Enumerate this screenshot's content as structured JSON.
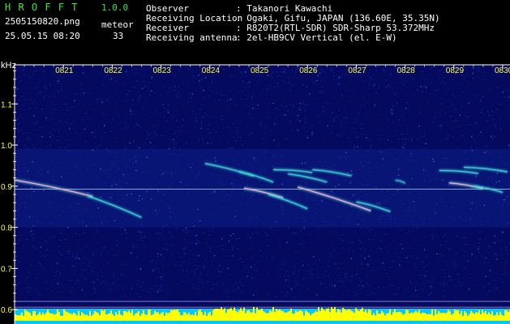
{
  "header": {
    "app_name": "H R O F F T",
    "version": "1.0.0",
    "filename": "2505150820.png",
    "datetime": "25.05.15 08:20",
    "meteor_label": "meteor",
    "meteor_count": "33",
    "info_labels": [
      "Observer",
      "Receiving Location",
      "Receiver",
      "Receiving antenna"
    ],
    "info_values": [
      ": Takanori Kawachi",
      ": Ogaki, Gifu, JAPAN (136.60E, 35.35N)",
      ": R820T2(RTL-SDR) SDR-Sharp 53.372MHz",
      ": 2el-HB9CV Vertical (el. E-W)"
    ]
  },
  "chart_data": {
    "type": "heatmap",
    "ylabel": "kHz",
    "y_ticks": [
      "1.1",
      "1.0",
      "0.9",
      "0.8",
      "0.7",
      "0.6"
    ],
    "y_tick_values": [
      1.1,
      1.0,
      0.9,
      0.8,
      0.7,
      0.6
    ],
    "x_ticks": [
      "0821",
      "0822",
      "0823",
      "0824",
      "0825",
      "0826",
      "0827",
      "0828",
      "0829",
      "0830"
    ],
    "x_tick_minutes": [
      21,
      22,
      23,
      24,
      25,
      26,
      27,
      28,
      29,
      30
    ],
    "x_range_minutes": [
      20.0,
      30.15
    ],
    "ylim": [
      0.565,
      1.195
    ],
    "carrier_khz": 0.893,
    "reference_lines_khz": [
      0.62,
      0.606
    ],
    "echo_traces": [
      {
        "t0": 20.0,
        "f0": 0.915,
        "t1": 21.6,
        "f1": 0.875,
        "intensity": "high"
      },
      {
        "t0": 21.5,
        "f0": 0.876,
        "t1": 22.6,
        "f1": 0.824,
        "intensity": "medium"
      },
      {
        "t0": 23.9,
        "f0": 0.955,
        "t1": 24.9,
        "f1": 0.925,
        "intensity": "medium"
      },
      {
        "t0": 24.6,
        "f0": 0.935,
        "t1": 25.3,
        "f1": 0.91,
        "intensity": "medium"
      },
      {
        "t0": 24.7,
        "f0": 0.895,
        "t1": 25.5,
        "f1": 0.872,
        "intensity": "high"
      },
      {
        "t0": 25.2,
        "f0": 0.88,
        "t1": 26.0,
        "f1": 0.845,
        "intensity": "medium"
      },
      {
        "t0": 25.3,
        "f0": 0.94,
        "t1": 26.1,
        "f1": 0.933,
        "intensity": "medium"
      },
      {
        "t0": 25.6,
        "f0": 0.93,
        "t1": 26.4,
        "f1": 0.91,
        "intensity": "medium"
      },
      {
        "t0": 26.1,
        "f0": 0.94,
        "t1": 26.9,
        "f1": 0.925,
        "intensity": "medium"
      },
      {
        "t0": 25.8,
        "f0": 0.898,
        "t1": 27.3,
        "f1": 0.84,
        "intensity": "high"
      },
      {
        "t0": 27.0,
        "f0": 0.862,
        "t1": 27.7,
        "f1": 0.838,
        "intensity": "medium"
      },
      {
        "t0": 27.8,
        "f0": 0.914,
        "t1": 28.0,
        "f1": 0.907,
        "intensity": "low"
      },
      {
        "t0": 28.7,
        "f0": 0.938,
        "t1": 29.5,
        "f1": 0.931,
        "intensity": "medium"
      },
      {
        "t0": 29.2,
        "f0": 0.946,
        "t1": 30.1,
        "f1": 0.935,
        "intensity": "medium"
      },
      {
        "t0": 28.9,
        "f0": 0.908,
        "t1": 29.6,
        "f1": 0.894,
        "intensity": "high"
      },
      {
        "t0": 29.4,
        "f0": 0.9,
        "t1": 30.0,
        "f1": 0.885,
        "intensity": "medium"
      }
    ],
    "colors": {
      "background_low": "#050a5e",
      "background_high": "#1a40c8",
      "carrier": "#8fd8ff",
      "echo_low": "#3ed8d8",
      "echo_high": "#ff66aa",
      "echo_core": "#ffffff",
      "axis": "#ffffff",
      "tick_label": "#ffff40",
      "level_bars": "#ffff00",
      "level_floor": "#00c8ff"
    }
  }
}
